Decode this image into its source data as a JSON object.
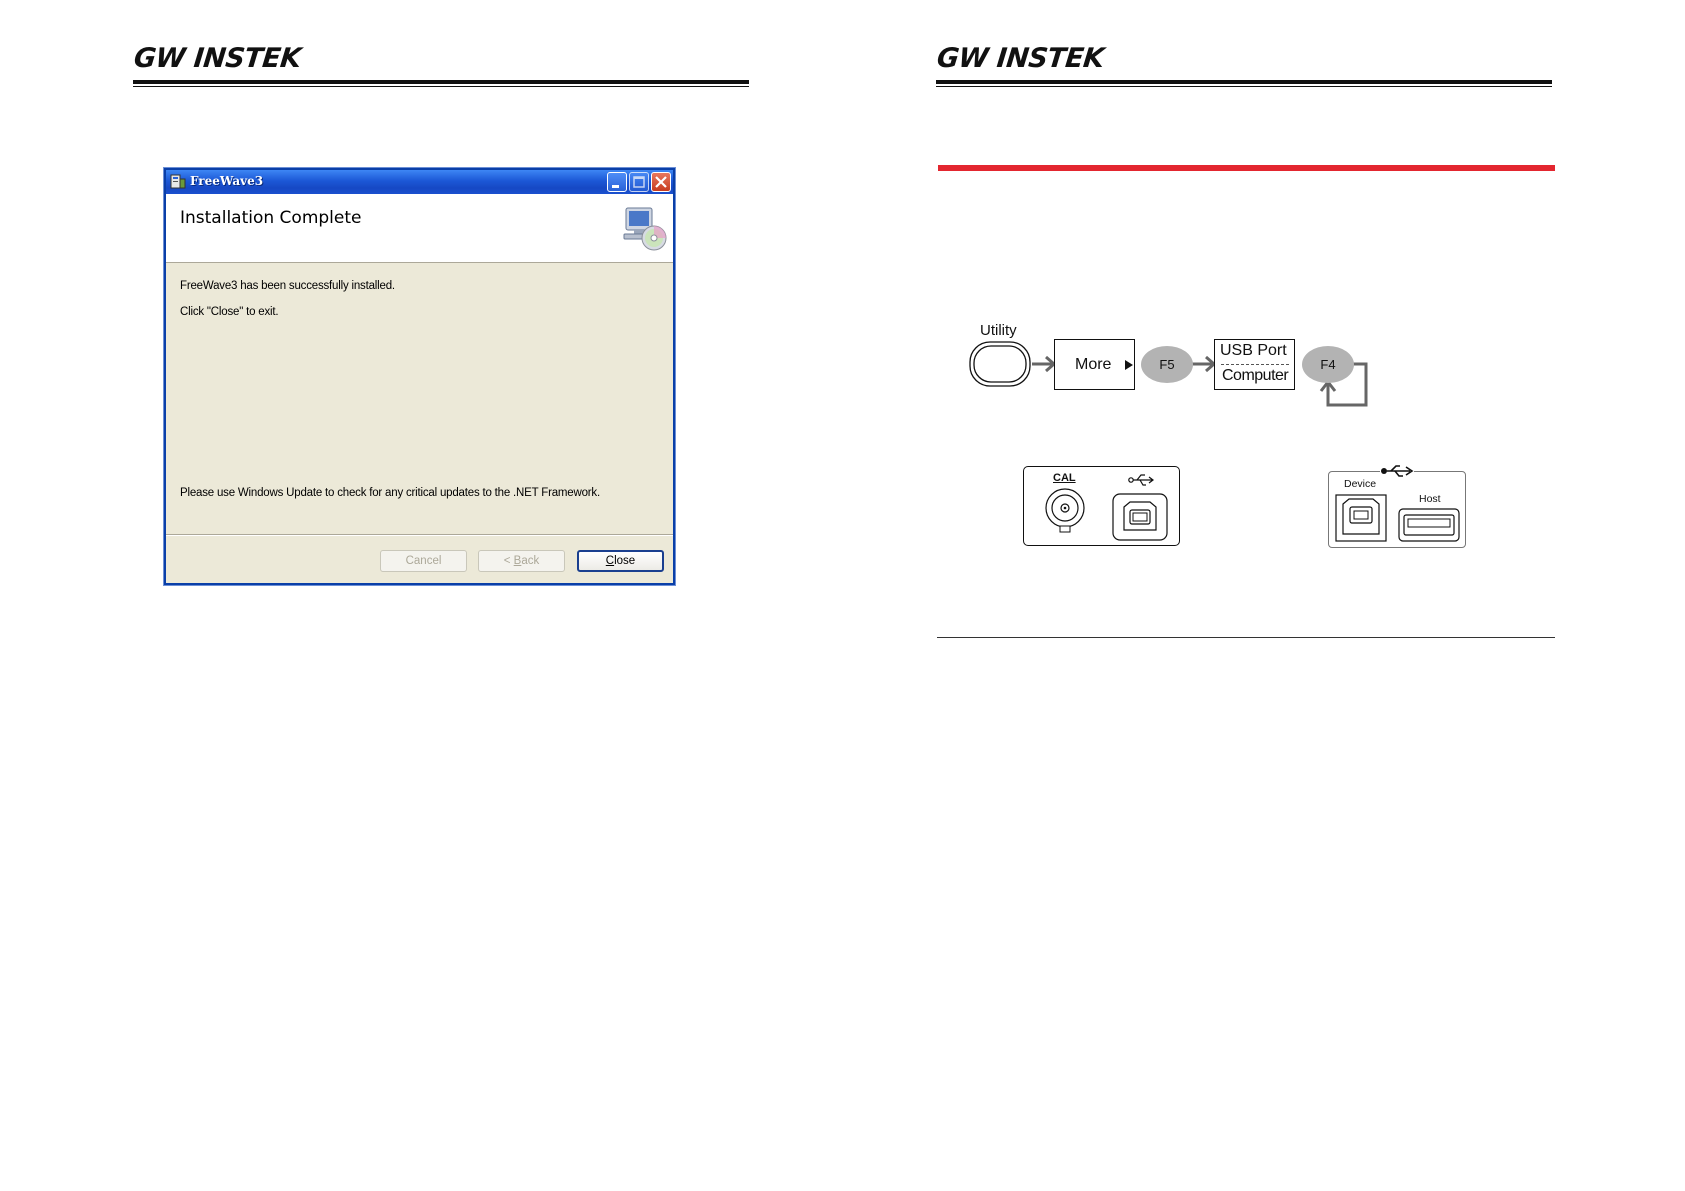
{
  "brand": {
    "logo_left": "GW INSTEK",
    "logo_right": "GW INSTEK"
  },
  "dialog": {
    "title": "FreeWave3",
    "heading": "Installation Complete",
    "message_1": "FreeWave3 has been successfully installed.",
    "message_2": "Click \"Close\" to exit.",
    "message_3": "Please use Windows Update to check for any critical updates to the .NET Framework.",
    "buttons": {
      "cancel": "Cancel",
      "back_prefix": "< ",
      "back_mnemonic": "B",
      "back_rest": "ack",
      "close_mnemonic": "C",
      "close_rest": "lose"
    }
  },
  "diagram": {
    "utility_label": "Utility",
    "more_label": "More",
    "f5_label": "F5",
    "usb_port_label": "USB Port",
    "computer_label": "Computer",
    "f4_label": "F4"
  },
  "panels": {
    "cal_label": "CAL",
    "device_label": "Device",
    "host_label": "Host"
  }
}
